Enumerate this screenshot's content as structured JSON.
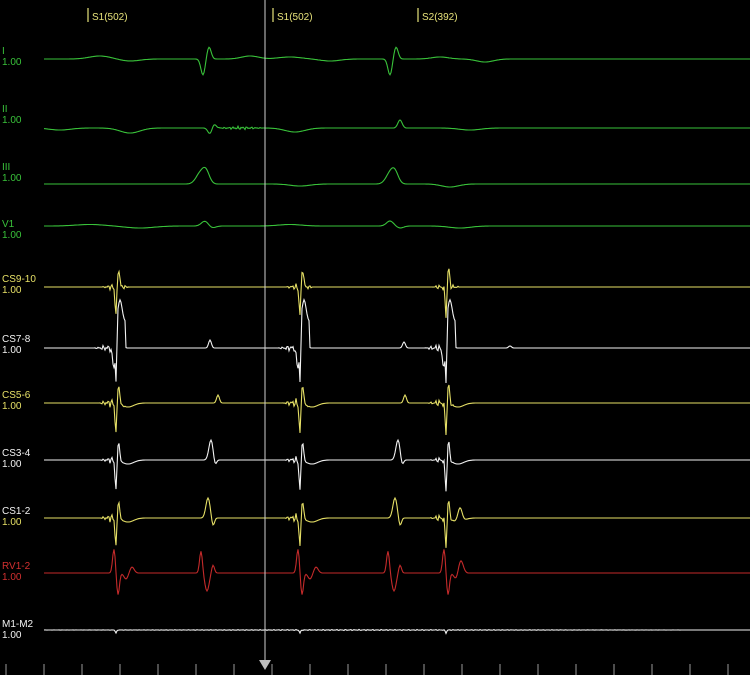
{
  "stim_markers": [
    {
      "label": "S1(502)",
      "color": "#e7e27a"
    },
    {
      "label": "S1(502)",
      "color": "#e7e27a"
    },
    {
      "label": "S2(392)",
      "color": "#e7e27a"
    }
  ],
  "channels": [
    {
      "name": "I",
      "gain": "1.00",
      "color": "#39c23a",
      "name_color": "#39c23a",
      "gain_color": "#39c23a"
    },
    {
      "name": "II",
      "gain": "1.00",
      "color": "#39c23a",
      "name_color": "#39c23a",
      "gain_color": "#39c23a"
    },
    {
      "name": "III",
      "gain": "1.00",
      "color": "#39c23a",
      "name_color": "#39c23a",
      "gain_color": "#39c23a"
    },
    {
      "name": "V1",
      "gain": "1.00",
      "color": "#39c23a",
      "name_color": "#39c23a",
      "gain_color": "#39c23a"
    },
    {
      "name": "CS9-10",
      "gain": "1.00",
      "color": "#e6e066",
      "name_color": "#e6e066",
      "gain_color": "#e6e066"
    },
    {
      "name": "CS7-8",
      "gain": "1.00",
      "color": "#f2f2f2",
      "name_color": "#f2f2f2",
      "gain_color": "#f2f2f2"
    },
    {
      "name": "CS5-6",
      "gain": "1.00",
      "color": "#e6e066",
      "name_color": "#e6e066",
      "gain_color": "#e6e066"
    },
    {
      "name": "CS3-4",
      "gain": "1.00",
      "color": "#f2f2f2",
      "name_color": "#f2f2f2",
      "gain_color": "#f2f2f2"
    },
    {
      "name": "CS1-2",
      "gain": "1.00",
      "color": "#e6e066",
      "name_color": "#f2f2f2",
      "gain_color": "#e6e066"
    },
    {
      "name": "RV1-2",
      "gain": "1.00",
      "color": "#c42a2a",
      "name_color": "#d23030",
      "gain_color": "#d23030"
    },
    {
      "name": "M1-M2",
      "gain": "1.00",
      "color": "#f2f2f2",
      "name_color": "#f2f2f2",
      "gain_color": "#f2f2f2"
    }
  ],
  "cursor": {
    "color": "#cfcfcf",
    "arrow_color": "#bdbdbd"
  },
  "colors": {
    "background": "#000000",
    "ticks": "#9a9a9a"
  }
}
